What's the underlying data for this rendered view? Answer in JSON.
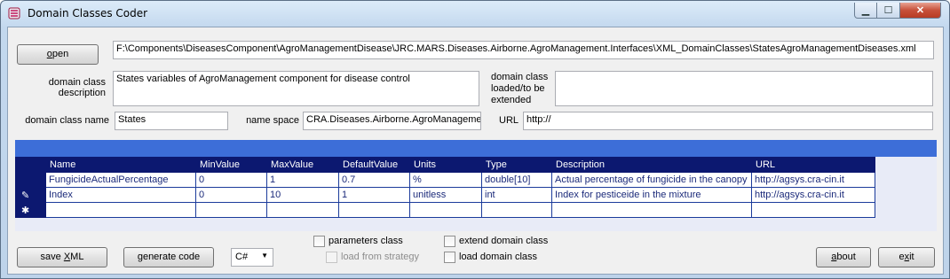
{
  "window": {
    "title": "Domain Classes Coder",
    "min_glyph": "▁",
    "max_glyph": "☐",
    "close_glyph": "✕"
  },
  "toolbar": {
    "open_label_u": "o",
    "open_label_rest": "pen",
    "file_path": "F:\\Components\\DiseasesComponent\\AgroManagementDisease\\JRC.MARS.Diseases.Airborne.AgroManagement.Interfaces\\XML_DomainClasses\\StatesAgroManagementDiseases.xml"
  },
  "form": {
    "description_label": "domain class description",
    "description_value": "States variables of AgroManagement component for disease control",
    "loaded_label": "domain class loaded/to be extended",
    "loaded_value": "",
    "name_label": "domain class name",
    "name_value": "States",
    "namespace_label": "name space",
    "namespace_value": "CRA.Diseases.Airborne.AgroManagement",
    "url_label": "URL",
    "url_value": "http://"
  },
  "grid": {
    "columns": [
      "Name",
      "MinValue",
      "MaxValue",
      "DefaultValue",
      "Units",
      "Type",
      "Description",
      "URL"
    ],
    "rows": [
      {
        "indicator": "",
        "cells": [
          "FungicideActualPercentage",
          "0",
          "1",
          "0.7",
          "%",
          "double[10]",
          "Actual percentage of fungicide in the canopy",
          "http://agsys.cra-cin.it"
        ]
      },
      {
        "indicator": "✎",
        "cells": [
          "Index",
          "0",
          "10",
          "1",
          "unitless",
          "int",
          "Index for pesticeide in the mixture",
          "http://agsys.cra-cin.it"
        ]
      },
      {
        "indicator": "✱",
        "cells": [
          "",
          "",
          "",
          "",
          "",
          "",
          "",
          ""
        ]
      }
    ]
  },
  "bottom": {
    "save_label_pre": "save ",
    "save_label_u": "X",
    "save_label_post": "ML",
    "generate_label": "generate code",
    "language_value": "C#",
    "parameters_class_label": "parameters class",
    "load_from_strategy_label": "load from strategy",
    "extend_domain_class_label": "extend domain class",
    "load_domain_class_label": "load domain class",
    "about_label_u": "a",
    "about_label_rest": "bout",
    "exit_label_pre": "e",
    "exit_label_u": "x",
    "exit_label_post": "it"
  },
  "colors": {
    "grid_header": "#0c1870",
    "grid_band": "#3d6ed8",
    "cell_text": "#1b2a7a"
  }
}
